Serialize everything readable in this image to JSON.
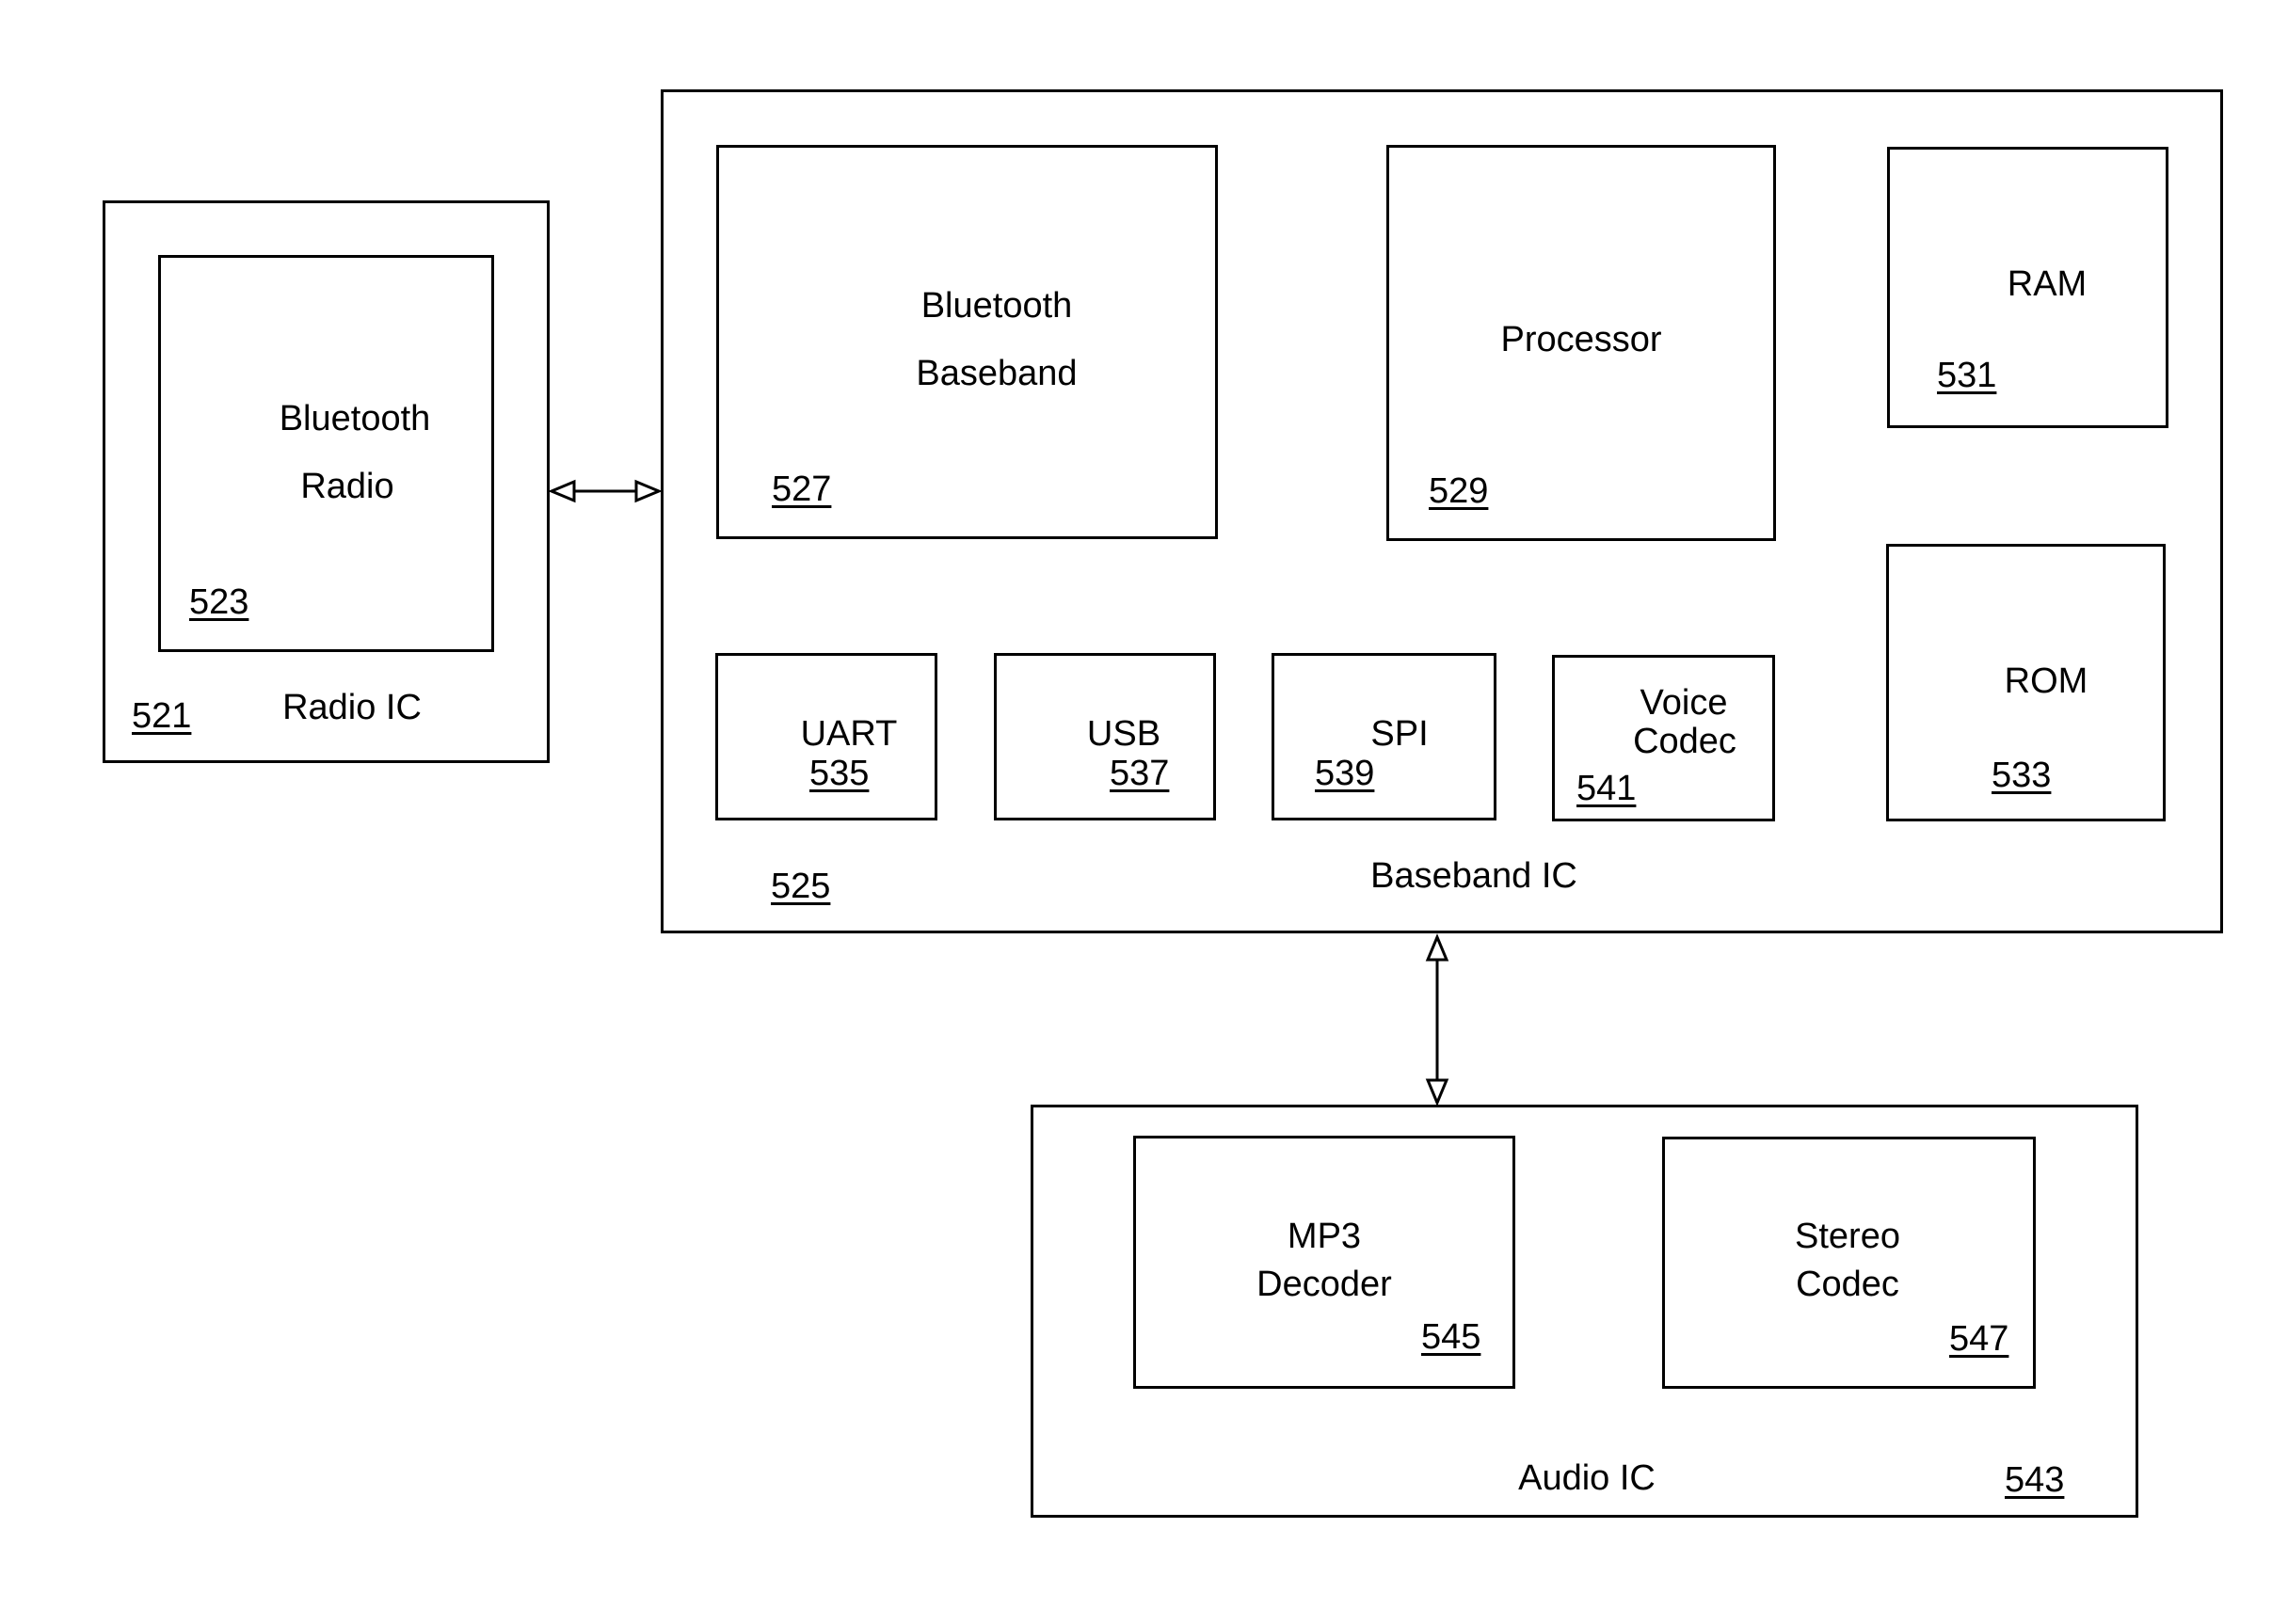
{
  "diagram": {
    "blocks": {
      "radio_ic": {
        "label": "Radio IC",
        "ref": "521"
      },
      "bluetooth_radio": {
        "line1": "Bluetooth",
        "line2": "Radio",
        "ref": "523"
      },
      "baseband_ic": {
        "label": "Baseband IC",
        "ref": "525"
      },
      "bluetooth_baseband": {
        "line1": "Bluetooth",
        "line2": "Baseband",
        "ref": "527"
      },
      "processor": {
        "label": "Processor",
        "ref": "529"
      },
      "ram": {
        "label": "RAM",
        "ref": "531"
      },
      "rom": {
        "label": "ROM",
        "ref": "533"
      },
      "uart": {
        "label": "UART",
        "ref": "535"
      },
      "usb": {
        "label": "USB",
        "ref": "537"
      },
      "spi": {
        "label": "SPI",
        "ref": "539"
      },
      "voice_codec": {
        "line1": "Voice",
        "line2": "Codec",
        "ref": "541"
      },
      "audio_ic": {
        "label": "Audio IC",
        "ref": "543"
      },
      "mp3_decoder": {
        "line1": "MP3",
        "line2": "Decoder",
        "ref": "545"
      },
      "stereo_codec": {
        "line1": "Stereo",
        "line2": "Codec",
        "ref": "547"
      }
    },
    "connections": [
      {
        "from": "Radio IC",
        "to": "Baseband IC",
        "type": "bidirectional"
      },
      {
        "from": "Baseband IC",
        "to": "Audio IC",
        "type": "bidirectional"
      }
    ]
  }
}
